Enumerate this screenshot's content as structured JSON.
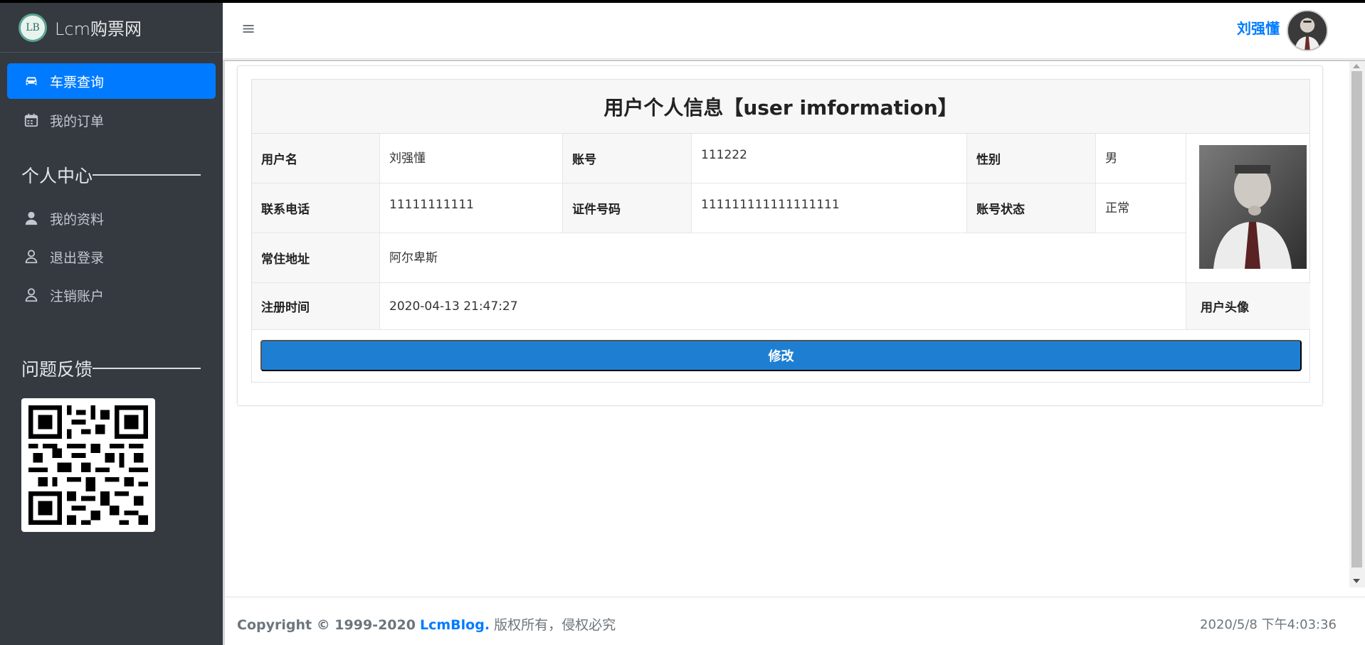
{
  "brand": {
    "logo_text": "LB",
    "name": "Lcm购票网"
  },
  "sidebar": {
    "items": [
      {
        "label": "车票查询",
        "icon": "car-icon",
        "active": true
      },
      {
        "label": "我的订单",
        "icon": "calendar-icon",
        "active": false
      }
    ],
    "section_personal": "个人中心",
    "personal_items": [
      {
        "label": "我的资料",
        "icon": "user-solid-icon"
      },
      {
        "label": "退出登录",
        "icon": "user-outline-icon"
      },
      {
        "label": "注销账户",
        "icon": "user-outline-icon"
      }
    ],
    "section_feedback": "问题反馈",
    "qr_icon": "qr-code-icon"
  },
  "header": {
    "menu_icon": "hamburger-icon",
    "menu_glyph": "≡",
    "username": "刘强懂"
  },
  "profile": {
    "title": "用户个人信息【user imformation】",
    "labels": {
      "username": "用户名",
      "account": "账号",
      "gender": "性别",
      "phone": "联系电话",
      "id_number": "证件号码",
      "status": "账号状态",
      "address": "常住地址",
      "register_time": "注册时间",
      "avatar": "用户头像"
    },
    "values": {
      "username": "刘强懂",
      "account": "111222",
      "gender": "男",
      "phone": "11111111111",
      "id_number": "111111111111111111",
      "status": "正常",
      "address": "阿尔卑斯",
      "register_time": "2020-04-13 21:47:27"
    },
    "edit_button": "修改"
  },
  "footer": {
    "copyright_prefix": "Copyright © 1999-2020",
    "brand_link": "LcmBlog.",
    "rights": "版权所有，侵权必究",
    "datetime": "2020/5/8 下午4:03:36"
  },
  "colors": {
    "sidebar_bg": "#343a40",
    "accent": "#007bff",
    "button": "#1e7fd2"
  }
}
